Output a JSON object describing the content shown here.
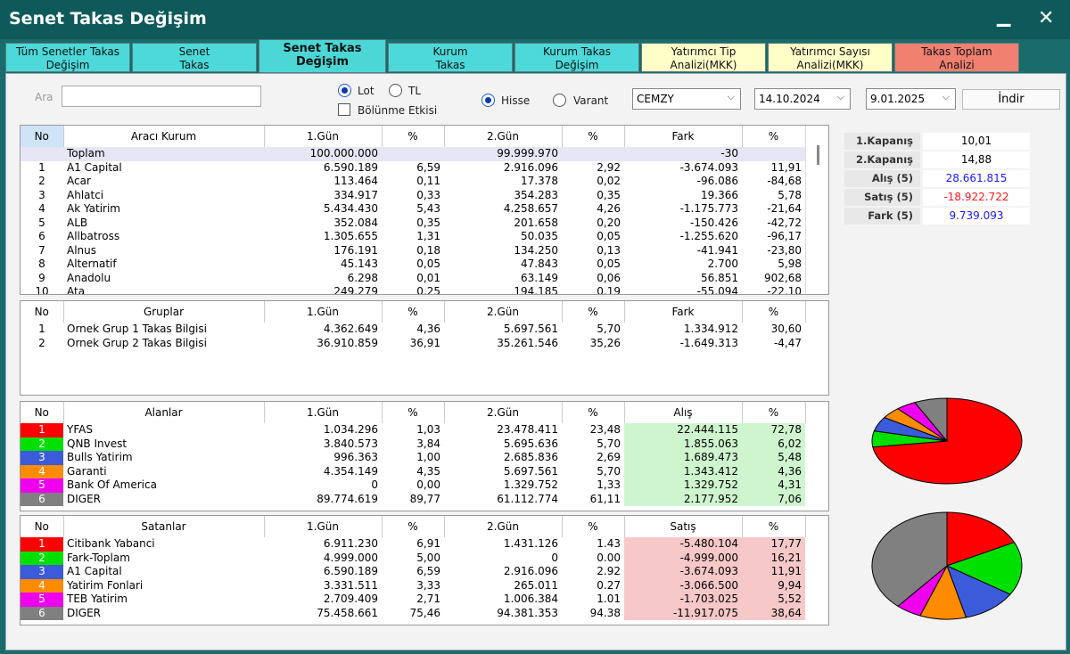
{
  "window": {
    "title": "Senet Takas Değişim"
  },
  "tabs": [
    {
      "line1": "Tüm Senetler Takas",
      "line2": "Değişim",
      "color": "#4dd9d9"
    },
    {
      "line1": "Senet",
      "line2": "Takas",
      "color": "#4dd9d9"
    },
    {
      "line1": "Senet Takas",
      "line2": "Değişim",
      "color": "#4cd6d6"
    },
    {
      "line1": "Kurum",
      "line2": "Takas",
      "color": "#4dd9d9"
    },
    {
      "line1": "Kurum Takas",
      "line2": "Değişim",
      "color": "#4dd9d9"
    },
    {
      "line1": "Yatırımcı Tip",
      "line2": "Analizi(MKK)",
      "color": "#ffffc8"
    },
    {
      "line1": "Yatırımcı Sayısı",
      "line2": "Analizi(MKK)",
      "color": "#ffffc8"
    },
    {
      "line1": "Takas Toplam",
      "line2": "Analizi",
      "color": "#f08070"
    }
  ],
  "filters": {
    "search_label": "Ara",
    "search_value": "",
    "lot_label": "Lot",
    "tl_label": "TL",
    "split_label": "Bölünme Etkisi",
    "hisse_label": "Hisse",
    "varant_label": "Varant",
    "symbol": "CEMZY",
    "date1": "14.10.2024",
    "date2": "9.01.2025",
    "download_label": "İndir"
  },
  "main_table": {
    "headers": [
      "No",
      "Aracı Kurum",
      "1.Gün",
      "%",
      "2.Gün",
      "%",
      "Fark",
      "%"
    ],
    "total": {
      "name": "Toplam",
      "day1": "100.000.000",
      "day2": "99.999.970",
      "diff": "-30"
    },
    "rows": [
      [
        "1",
        "A1 Capital",
        "6.590.189",
        "6,59",
        "2.916.096",
        "2,92",
        "-3.674.093",
        "11,91"
      ],
      [
        "2",
        "Acar",
        "113.464",
        "0,11",
        "17.378",
        "0,02",
        "-96.086",
        "-84,68"
      ],
      [
        "3",
        "Ahlatci",
        "334.917",
        "0,33",
        "354.283",
        "0,35",
        "19.366",
        "5,78"
      ],
      [
        "4",
        "Ak Yatirim",
        "5.434.430",
        "5,43",
        "4.258.657",
        "4,26",
        "-1.175.773",
        "-21,64"
      ],
      [
        "5",
        "ALB",
        "352.084",
        "0,35",
        "201.658",
        "0,20",
        "-150.426",
        "-42,72"
      ],
      [
        "6",
        "Allbatross",
        "1.305.655",
        "1,31",
        "50.035",
        "0,05",
        "-1.255.620",
        "-96,17"
      ],
      [
        "7",
        "Alnus",
        "176.191",
        "0,18",
        "134.250",
        "0,13",
        "-41.941",
        "-23,80"
      ],
      [
        "8",
        "Alternatif",
        "45.143",
        "0,05",
        "47.843",
        "0,05",
        "2.700",
        "5,98"
      ],
      [
        "9",
        "Anadolu",
        "6.298",
        "0,01",
        "63.149",
        "0,06",
        "56.851",
        "902,68"
      ],
      [
        "10",
        "Ata",
        "249.279",
        "0,25",
        "194.185",
        "0,19",
        "-55.094",
        "-22,10"
      ]
    ]
  },
  "groups_table": {
    "headers": [
      "No",
      "Gruplar",
      "1.Gün",
      "%",
      "2.Gün",
      "%",
      "Fark",
      "%"
    ],
    "rows": [
      [
        "1",
        "Ornek Grup 1 Takas Bilgisi",
        "4.362.649",
        "4,36",
        "5.697.561",
        "5,70",
        "1.334.912",
        "30,60"
      ],
      [
        "2",
        "Ornek Grup 2 Takas Bilgisi",
        "36.910.859",
        "36,91",
        "35.261.546",
        "35,26",
        "-1.649.313",
        "-4,47"
      ]
    ]
  },
  "buyers_table": {
    "headers": [
      "No",
      "Alanlar",
      "1.Gün",
      "%",
      "2.Gün",
      "%",
      "Alış",
      "%"
    ],
    "rows": [
      [
        "1",
        "YFAS",
        "1.034.296",
        "1,03",
        "23.478.411",
        "23,48",
        "22.444.115",
        "72,78"
      ],
      [
        "2",
        "QNB Invest",
        "3.840.573",
        "3,84",
        "5.695.636",
        "5,70",
        "1.855.063",
        "6,02"
      ],
      [
        "3",
        "Bulls Yatirim",
        "996.363",
        "1,00",
        "2.685.836",
        "2,69",
        "1.689.473",
        "5,48"
      ],
      [
        "4",
        "Garanti",
        "4.354.149",
        "4,35",
        "5.697.561",
        "5,70",
        "1.343.412",
        "4,36"
      ],
      [
        "5",
        "Bank Of America",
        "0",
        "0,00",
        "1.329.752",
        "1,33",
        "1.329.752",
        "4,31"
      ],
      [
        "6",
        "DIGER",
        "89.774.619",
        "89,77",
        "61.112.774",
        "61,11",
        "2.177.952",
        "7,06"
      ]
    ],
    "colors": [
      "#ff0000",
      "#00e000",
      "#3b5bdb",
      "#ff8c00",
      "#ee00ee",
      "#808080"
    ]
  },
  "sellers_table": {
    "headers": [
      "No",
      "Satanlar",
      "1.Gün",
      "%",
      "2.Gün",
      "%",
      "Satış",
      "%"
    ],
    "rows": [
      [
        "1",
        "Citibank Yabanci",
        "6.911.230",
        "6,91",
        "1.431.126",
        "1.43",
        "-5.480.104",
        "17,77"
      ],
      [
        "2",
        "Fark-Toplam",
        "4.999.000",
        "5,00",
        "0",
        "0.00",
        "-4.999.000",
        "16,21"
      ],
      [
        "3",
        "A1 Capital",
        "6.590.189",
        "6,59",
        "2.916.096",
        "2.92",
        "-3.674.093",
        "11,91"
      ],
      [
        "4",
        "Yatirim Fonlari",
        "3.331.511",
        "3,33",
        "265.011",
        "0.27",
        "-3.066.500",
        "9,94"
      ],
      [
        "5",
        "TEB Yatirim",
        "2.709.409",
        "2,71",
        "1.006.384",
        "1.01",
        "-1.703.025",
        "5,52"
      ],
      [
        "6",
        "DIGER",
        "75.458.661",
        "75,46",
        "94.381.353",
        "94.38",
        "-11.917.075",
        "38,64"
      ]
    ],
    "colors": [
      "#ff0000",
      "#00e000",
      "#3b5bdb",
      "#ff8c00",
      "#ee00ee",
      "#808080"
    ]
  },
  "summary": [
    {
      "label": "1.Kapanış",
      "value": "10,01",
      "color": "#000000"
    },
    {
      "label": "2.Kapanış",
      "value": "14,88",
      "color": "#000000"
    },
    {
      "label": "Alış (5)",
      "value": "28.661.815",
      "color": "#1a1aff"
    },
    {
      "label": "Satış (5)",
      "value": "-18.922.722",
      "color": "#ff1a1a"
    },
    {
      "label": "Fark (5)",
      "value": "9.739.093",
      "color": "#1a1aff"
    }
  ],
  "pies": {
    "buyers": [
      72.78,
      6.02,
      5.48,
      4.36,
      4.31,
      7.06
    ],
    "sellers": [
      17.77,
      16.21,
      11.91,
      9.94,
      5.52,
      38.64
    ]
  }
}
